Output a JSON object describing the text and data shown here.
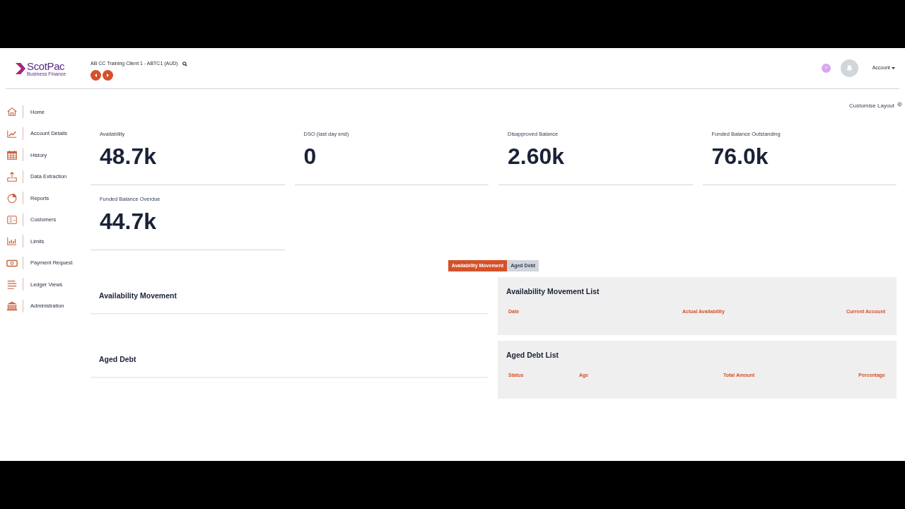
{
  "header": {
    "logo": {
      "name": "ScotPac",
      "tagline": "Business Finance"
    },
    "client": "AB CC Training Client 1 - ABTC1 (AUD)",
    "help": "?",
    "account": "Account"
  },
  "sidebar": {
    "items": [
      {
        "label": "Home"
      },
      {
        "label": "Account Details"
      },
      {
        "label": "History"
      },
      {
        "label": "Data Extraction"
      },
      {
        "label": "Reports"
      },
      {
        "label": "Customers"
      },
      {
        "label": "Limits"
      },
      {
        "label": "Payment Request"
      },
      {
        "label": "Ledger Views"
      },
      {
        "label": "Administration"
      }
    ]
  },
  "customise_layout": "Customise Layout",
  "metrics": [
    {
      "label": "Availability",
      "value": "48.7k"
    },
    {
      "label": "DSO (last day end)",
      "value": "0"
    },
    {
      "label": "Disapproved Balance",
      "value": "2.60k"
    },
    {
      "label": "Funded Balance Outstanding",
      "value": "76.0k"
    },
    {
      "label": "Funded Balance Overdue",
      "value": "44.7k"
    }
  ],
  "tabs": [
    {
      "label": "Availability Movement",
      "selected": true
    },
    {
      "label": "Aged Debt",
      "selected": false
    }
  ],
  "sections": [
    {
      "title": "Availability Movement",
      "list": {
        "title": "Availability Movement List",
        "columns": [
          "Date",
          "Actual Availability",
          "Current Account"
        ]
      }
    },
    {
      "title": "Aged Debt",
      "list": {
        "title": "Aged Debt List",
        "columns": [
          "Status",
          "Age",
          "Total Amount",
          "Percentage"
        ]
      }
    }
  ]
}
